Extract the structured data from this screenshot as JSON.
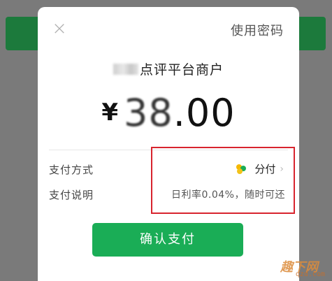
{
  "dialog": {
    "close_icon": "close-icon",
    "password_link": "使用密码",
    "merchant_suffix": "点评平台商户",
    "currency": "¥",
    "amount_blurred": "38",
    "amount_decimal": ".00",
    "payment_method_label": "支付方式",
    "payment_note_label": "支付说明",
    "payment_method_value": "分付",
    "payment_note_value": "日利率0.04%，随时可还",
    "confirm_button": "确认支付"
  },
  "watermark": {
    "main": "趣下网",
    "sub": "qzd.com"
  },
  "colors": {
    "accent": "#1aad56",
    "highlight": "#d8242e"
  }
}
